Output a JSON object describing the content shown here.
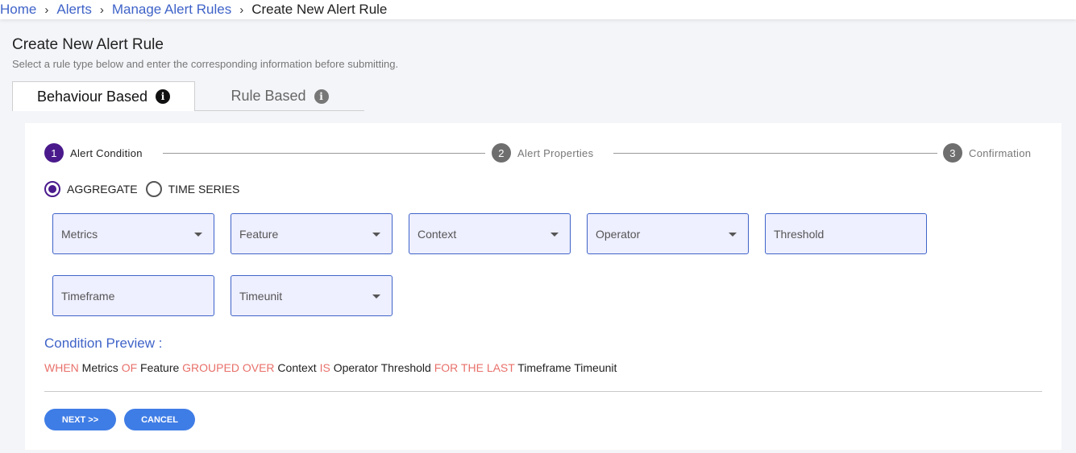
{
  "breadcrumb": {
    "items": [
      "Home",
      "Alerts",
      "Manage Alert Rules"
    ],
    "current": "Create New Alert Rule",
    "separator": "›"
  },
  "header": {
    "title": "Create New Alert Rule",
    "subtitle": "Select a rule type below and enter the corresponding information before submitting."
  },
  "tabs": [
    {
      "label": "Behaviour Based",
      "active": true,
      "icon": "info-icon"
    },
    {
      "label": "Rule Based",
      "active": false,
      "icon": "info-icon"
    }
  ],
  "stepper": {
    "steps": [
      {
        "number": "1",
        "label": "Alert Condition",
        "active": true
      },
      {
        "number": "2",
        "label": "Alert Properties",
        "active": false
      },
      {
        "number": "3",
        "label": "Confirmation",
        "active": false
      }
    ]
  },
  "mode": {
    "options": [
      "AGGREGATE",
      "TIME SERIES"
    ],
    "selected": "AGGREGATE"
  },
  "fields": {
    "metrics": "Metrics",
    "feature": "Feature",
    "context": "Context",
    "operator": "Operator",
    "threshold": "Threshold",
    "timeframe": "Timeframe",
    "timeunit": "Timeunit"
  },
  "preview": {
    "title": "Condition Preview :",
    "parts": [
      {
        "text": "WHEN",
        "keyword": true
      },
      {
        "text": "Metrics",
        "keyword": false
      },
      {
        "text": "OF",
        "keyword": true
      },
      {
        "text": "Feature",
        "keyword": false
      },
      {
        "text": "GROUPED OVER",
        "keyword": true
      },
      {
        "text": "Context",
        "keyword": false
      },
      {
        "text": "IS",
        "keyword": true
      },
      {
        "text": "Operator",
        "keyword": false
      },
      {
        "text": "Threshold",
        "keyword": false
      },
      {
        "text": "FOR THE LAST",
        "keyword": true
      },
      {
        "text": "Timeframe",
        "keyword": false
      },
      {
        "text": "Timeunit",
        "keyword": false
      }
    ]
  },
  "buttons": {
    "next": "NEXT >>",
    "cancel": "CANCEL"
  },
  "colors": {
    "accent": "#3f63c8",
    "step_active": "#4a1a8c",
    "keyword": "#e8706a",
    "button": "#3f7de6"
  }
}
